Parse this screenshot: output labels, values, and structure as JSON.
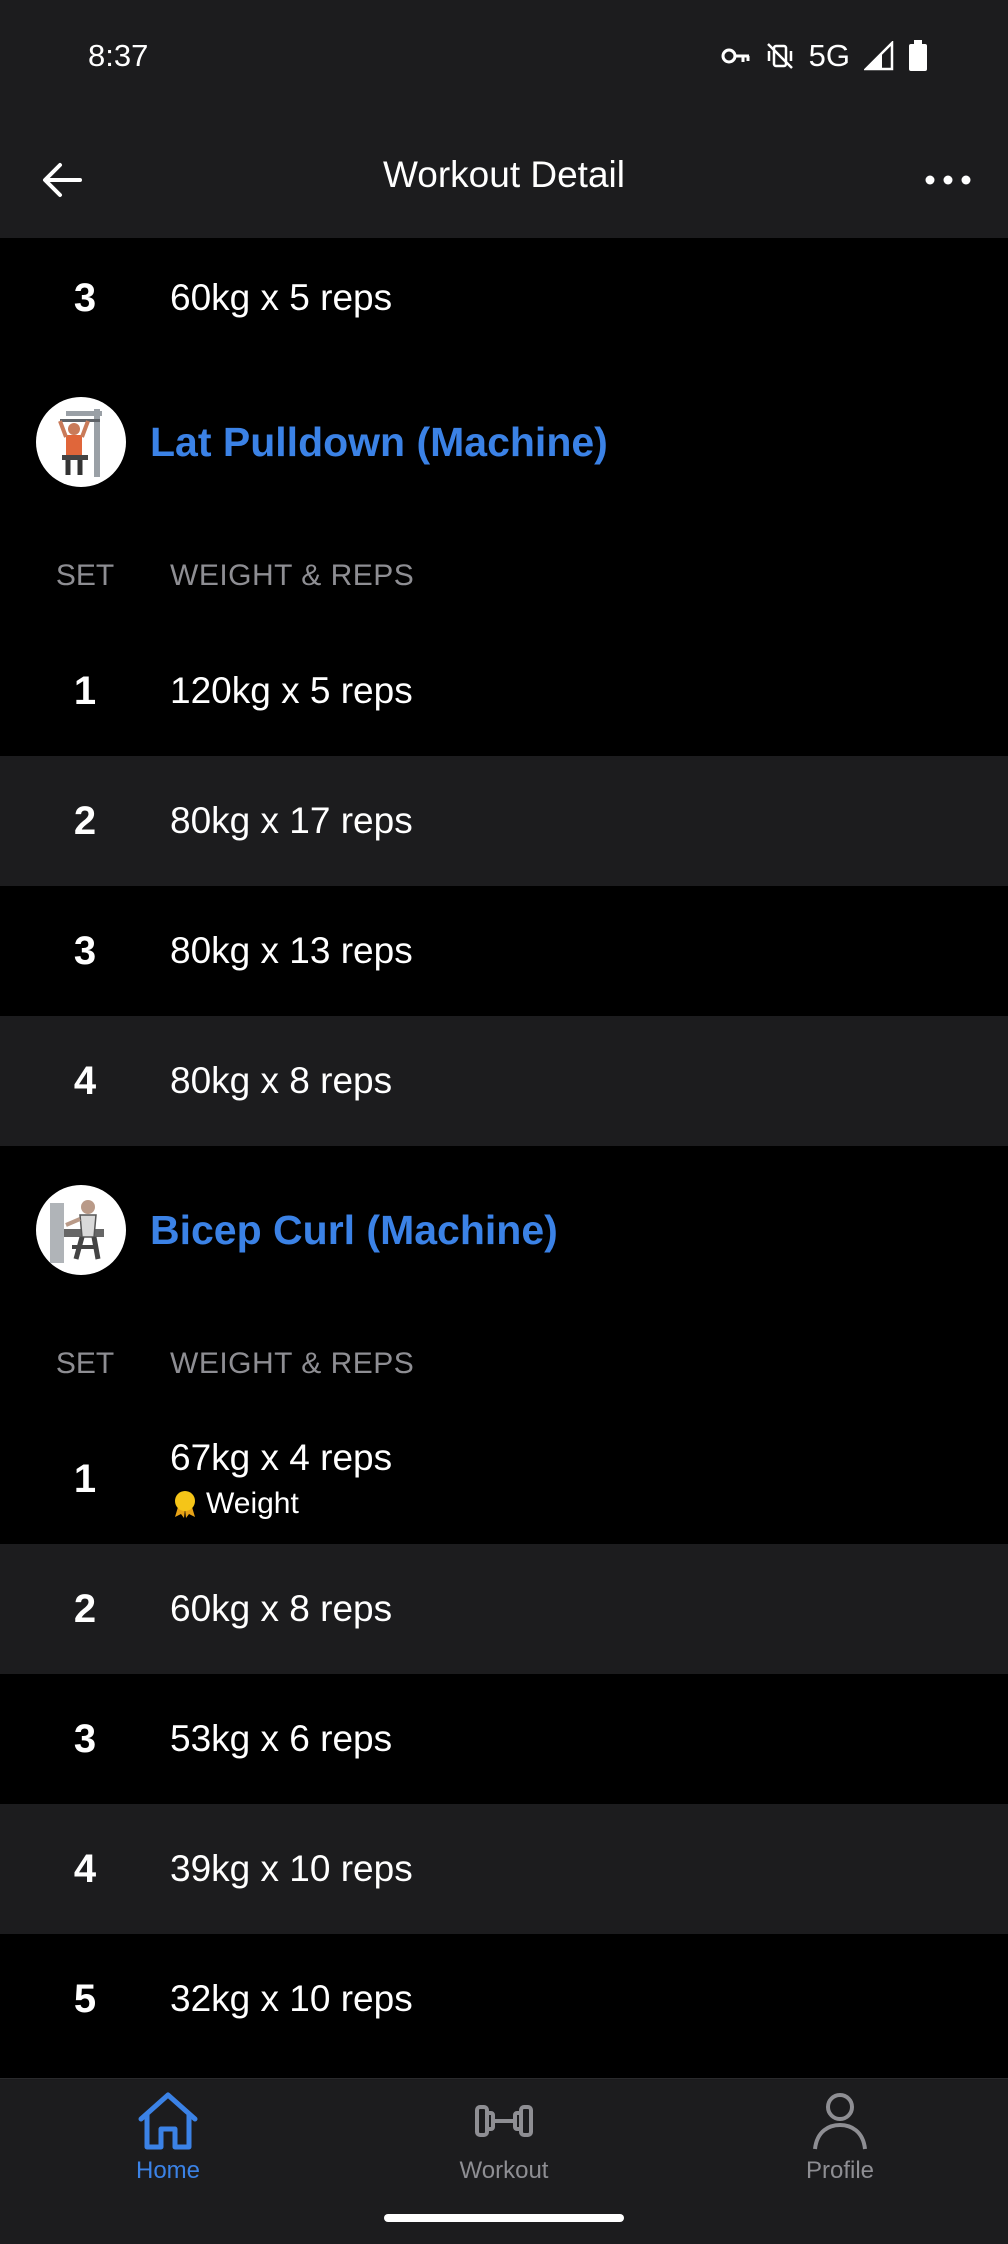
{
  "status_bar": {
    "time": "8:37",
    "network": "5G",
    "icons": [
      "vpn-key-icon",
      "vibrate-off-icon",
      "signal-icon",
      "battery-icon"
    ]
  },
  "app_bar": {
    "title": "Workout Detail",
    "back_icon": "arrow-left-icon",
    "more_icon": "more-horizontal-icon"
  },
  "top_row": {
    "set": "3",
    "value": "60kg x 5 reps"
  },
  "columns": {
    "set": "SET",
    "weight_reps": "WEIGHT & REPS"
  },
  "exercises": [
    {
      "name": "Lat Pulldown (Machine)",
      "sets": [
        {
          "set": "1",
          "value": "120kg x 5 reps"
        },
        {
          "set": "2",
          "value": "80kg x 17 reps"
        },
        {
          "set": "3",
          "value": "80kg x 13 reps"
        },
        {
          "set": "4",
          "value": "80kg x 8 reps"
        }
      ]
    },
    {
      "name": "Bicep Curl (Machine)",
      "sets": [
        {
          "set": "1",
          "value": "67kg x 4 reps",
          "badge": "Weight"
        },
        {
          "set": "2",
          "value": "60kg x 8 reps"
        },
        {
          "set": "3",
          "value": "53kg x 6 reps"
        },
        {
          "set": "4",
          "value": "39kg x 10 reps"
        },
        {
          "set": "5",
          "value": "32kg x 10 reps"
        }
      ]
    }
  ],
  "nav": {
    "home": "Home",
    "workout": "Workout",
    "profile": "Profile"
  },
  "colors": {
    "accent": "#3b82e6",
    "background": "#000000",
    "surface": "#1c1c1e",
    "muted": "#8e8e93",
    "medal": "#f5c518"
  }
}
